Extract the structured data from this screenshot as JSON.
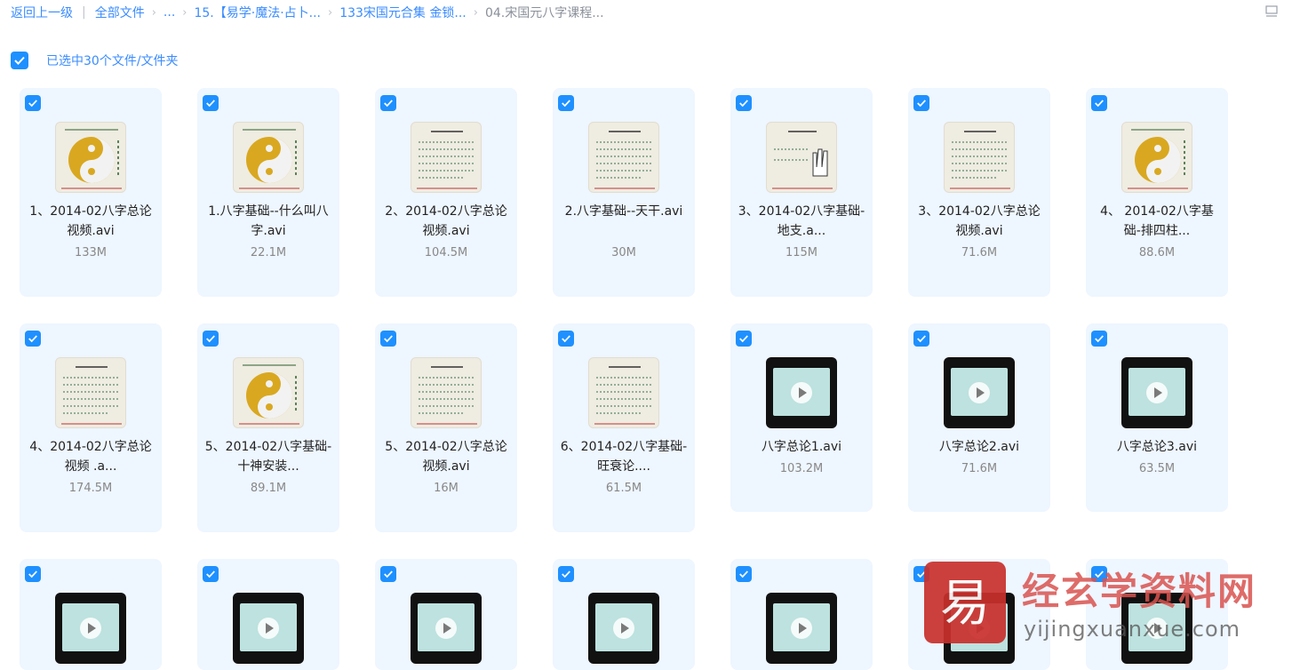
{
  "breadcrumb": {
    "back": "返回上一级",
    "items": [
      "全部文件",
      "...",
      "15.【易学·魔法·占卜...",
      "133宋国元合集 金锁...",
      "04.宋国元八字课程..."
    ]
  },
  "selection": {
    "text": "已选中30个文件/文件夹"
  },
  "files": [
    {
      "name": "1、2014-02八字总论视频.avi",
      "size": "133M",
      "thumb": "yinyang"
    },
    {
      "name": "1.八字基础--什么叫八字.avi",
      "size": "22.1M",
      "thumb": "yinyang"
    },
    {
      "name": "2、2014-02八字总论视频.avi",
      "size": "104.5M",
      "thumb": "text"
    },
    {
      "name": "2.八字基础--天干.avi",
      "size": "30M",
      "thumb": "text"
    },
    {
      "name": "3、2014-02八字基础-地支.a...",
      "size": "115M",
      "thumb": "hand"
    },
    {
      "name": "3、2014-02八字总论视频.avi",
      "size": "71.6M",
      "thumb": "text"
    },
    {
      "name": "4、 2014-02八字基础-排四柱...",
      "size": "88.6M",
      "thumb": "yinyang"
    },
    {
      "name": "4、2014-02八字总论视频 .a...",
      "size": "174.5M",
      "thumb": "text"
    },
    {
      "name": "5、2014-02八字基础-十神安装...",
      "size": "89.1M",
      "thumb": "yinyang"
    },
    {
      "name": "5、2014-02八字总论视频.avi",
      "size": "16M",
      "thumb": "text"
    },
    {
      "name": "6、2014-02八字基础-旺衰论....",
      "size": "61.5M",
      "thumb": "text"
    },
    {
      "name": "八字总论1.avi",
      "size": "103.2M",
      "thumb": "video"
    },
    {
      "name": "八字总论2.avi",
      "size": "71.6M",
      "thumb": "video"
    },
    {
      "name": "八字总论3.avi",
      "size": "63.5M",
      "thumb": "video"
    },
    {
      "name": "",
      "size": "",
      "thumb": "video"
    },
    {
      "name": "",
      "size": "",
      "thumb": "video"
    },
    {
      "name": "",
      "size": "",
      "thumb": "video"
    },
    {
      "name": "",
      "size": "",
      "thumb": "video"
    },
    {
      "name": "",
      "size": "",
      "thumb": "video"
    },
    {
      "name": "",
      "size": "",
      "thumb": "video"
    },
    {
      "name": "",
      "size": "",
      "thumb": "video"
    }
  ],
  "watermark": {
    "title": "经玄学资料网",
    "url": "yijingxuanxue.com",
    "logo_char": "易"
  },
  "colors": {
    "accent": "#1e90ff",
    "link": "#3b8cff",
    "card_bg": "#eef6ff"
  }
}
